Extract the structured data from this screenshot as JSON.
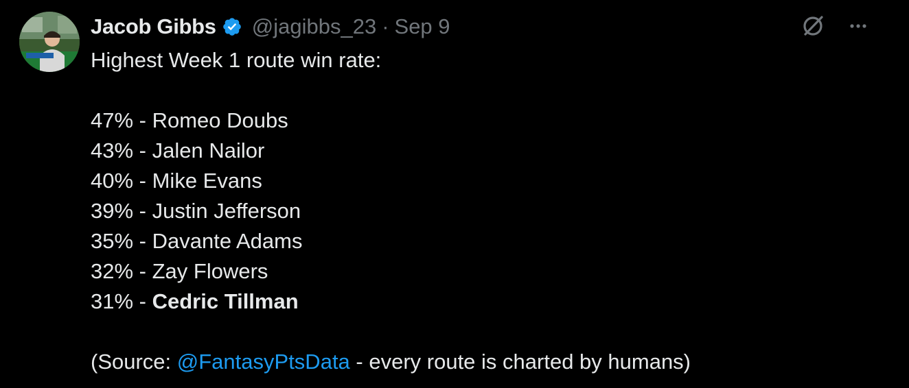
{
  "tweet": {
    "display_name": "Jacob Gibbs",
    "handle": "@jagibbs_23",
    "separator": "·",
    "date": "Sep 9",
    "title_line": "Highest Week 1 route win rate:",
    "rankings": [
      {
        "rate": "47%",
        "sep": " - ",
        "player": "Romeo Doubs"
      },
      {
        "rate": "43%",
        "sep": " - ",
        "player": "Jalen Nailor"
      },
      {
        "rate": "40%",
        "sep": " - ",
        "player": "Mike Evans"
      },
      {
        "rate": "39%",
        "sep": " - ",
        "player": "Justin Jefferson"
      },
      {
        "rate": "35%",
        "sep": " - ",
        "player": "Davante Adams"
      },
      {
        "rate": "32%",
        "sep": " - ",
        "player": "Zay Flowers"
      },
      {
        "rate": "31%",
        "sep": " - ",
        "player": "Cedric Tillman"
      }
    ],
    "source_prefix": "(Source: ",
    "source_mention": "@FantasyPtsData",
    "source_suffix": " - every route is charted by humans)"
  },
  "icons": {
    "verified": "verified-badge-icon",
    "grok": "grok-icon",
    "more": "more-icon"
  },
  "colors": {
    "background": "#000000",
    "text": "#e7e9ea",
    "secondary": "#71767b",
    "accent": "#1d9bf0"
  }
}
